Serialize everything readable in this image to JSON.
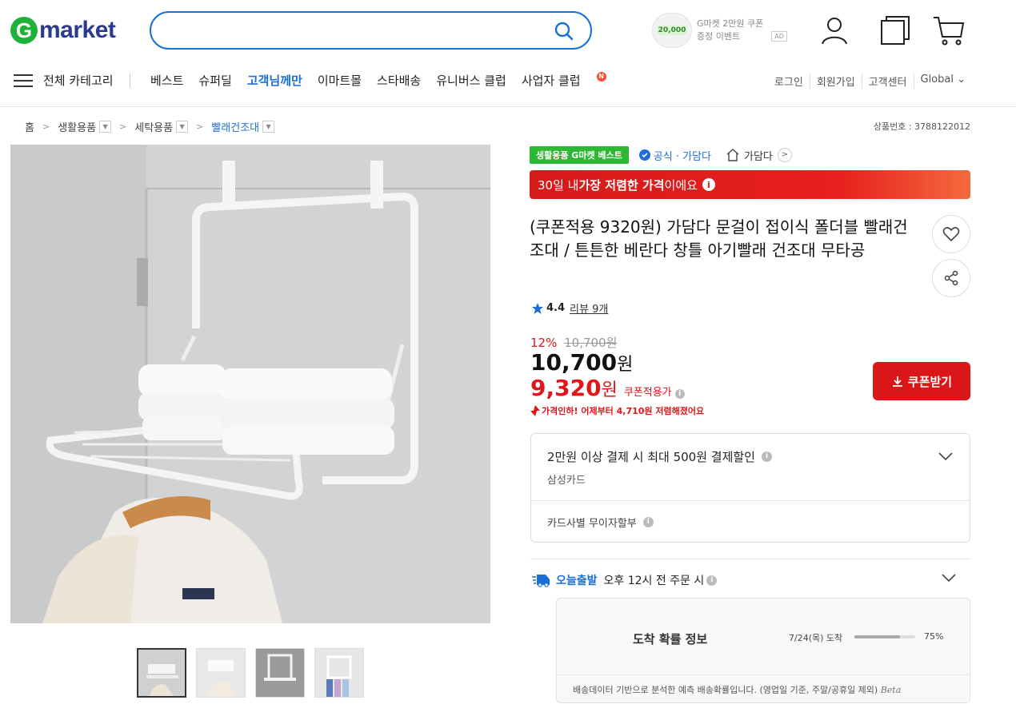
{
  "header": {
    "logo_g": "G",
    "logo_text": "market",
    "search_placeholder": "",
    "promo_amount": "20,000",
    "promo_line1": "G마켓 2만원 쿠폰",
    "promo_line2": "증정 이벤트",
    "promo_ad": "AD"
  },
  "nav": {
    "category": "전체 카테고리",
    "links": [
      "베스트",
      "슈퍼딜",
      "고객님께만",
      "이마트몰",
      "스타배송",
      "유니버스 클럽",
      "사업자 클럽"
    ],
    "new_badge": "N",
    "right": [
      "로그인",
      "회원가입",
      "고객센터",
      "Global ⌄"
    ]
  },
  "breadcrumb": {
    "items": [
      "홈",
      "생활용품",
      "세탁용품",
      "빨래건조대"
    ],
    "product_no": "상품번호 : 3788122012"
  },
  "badges": {
    "best": "생활용품 G마켓 베스트",
    "official": "공식 · 가담다",
    "shop": "가담다"
  },
  "lowest": {
    "prefix": "30일 내 ",
    "bold": "가장 저렴한 가격",
    "suffix": "이에요",
    "info": "i"
  },
  "product": {
    "title": "(쿠폰적용 9320원) 가담다 문걸이 접이식 폴더블 빨래건조대 / 튼튼한 베란다 창틀 아기빨래 건조대 무타공",
    "rating": "4.4",
    "reviews": "리뷰 9개",
    "discount_rate": "12%",
    "original_price": "10,700원",
    "price_num": "10,700",
    "price_unit": "원",
    "coupon_price_num": "9,320",
    "coupon_price_unit": "원",
    "coupon_label": "쿠폰적용가",
    "price_drop": "가격인하! 어제부터 4,710원 저렴해졌어요",
    "coupon_button": "쿠폰받기"
  },
  "card": {
    "title": "2만원 이상 결제 시 최대 500원 결제할인",
    "sub": "삼성카드",
    "installment": "카드사별 무이자할부"
  },
  "shipping": {
    "today": "오늘출발",
    "time": "오후 12시 전 주문 시"
  },
  "arrival": {
    "title": "도착 확률 정보",
    "date": "7/24(목) 도착",
    "percent_text": "75%",
    "percent": 0.75,
    "note": "배송데이터 기반으로 분석한 예측 배송확률입니다. (영업일 기준, 주말/공휴일 제외)",
    "beta": "Beta"
  },
  "colors": {
    "brand_green": "#1eb23a",
    "brand_blue": "#1a6fd6",
    "accent_red": "#e0161a"
  }
}
